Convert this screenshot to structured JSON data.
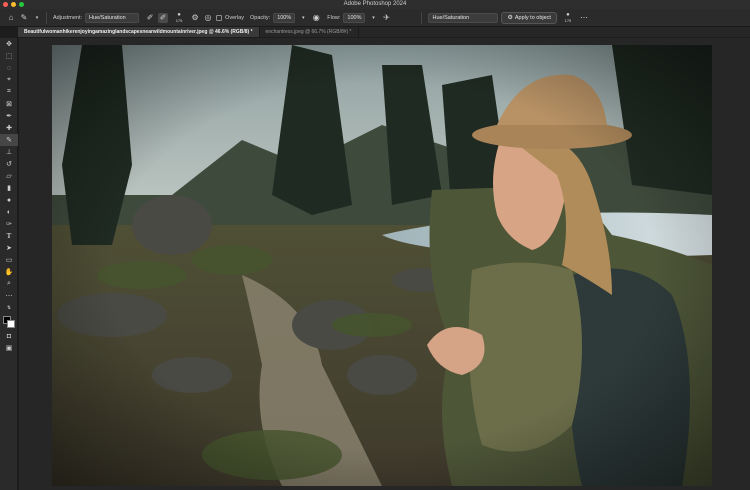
{
  "app": {
    "title": "Adobe Photoshop 2024"
  },
  "options_bar": {
    "adjustment_label": "Adjustment:",
    "adjustment_value": "Hue/Saturation",
    "brush_size": "175",
    "overlay_label": "Overlay",
    "opacity_label": "Opacity:",
    "opacity_value": "100%",
    "flow_label": "Flow:",
    "flow_value": "100%",
    "adjustment_dropdown": "Hue/Saturation",
    "apply_label": "Apply to object",
    "size_value": "175"
  },
  "tabs": [
    {
      "label": "Beautifulwomanhikerenjoyingamazinglandscapesnearwildmountainriver.jpeg @ 46.6% (RGB/8) *",
      "active": true
    },
    {
      "label": "enchantress.jpeg @ 66.7% (RGB/8#) *",
      "active": false
    }
  ],
  "tools": [
    "move-tool-icon",
    "marquee-tool-icon",
    "lasso-tool-icon",
    "object-select-icon",
    "crop-tool-icon",
    "frame-tool-icon",
    "eyedropper-icon",
    "healing-brush-icon",
    "brush-tool-icon",
    "clone-stamp-icon",
    "history-brush-icon",
    "eraser-icon",
    "gradient-icon",
    "blur-icon",
    "dodge-icon",
    "pen-tool-icon",
    "type-tool-icon",
    "path-select-icon",
    "rectangle-tool-icon",
    "hand-tool-icon",
    "zoom-tool-icon",
    "more-tools-icon"
  ],
  "colors": {
    "foreground": "#000000",
    "background": "#ffffff",
    "accent": "#2d8ceb"
  }
}
